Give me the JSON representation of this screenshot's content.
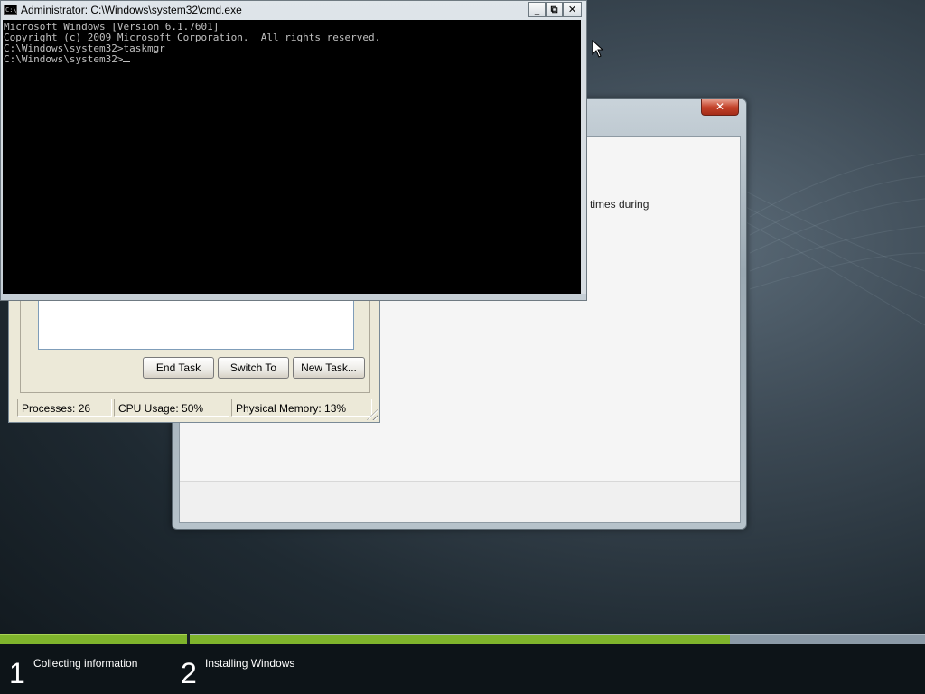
{
  "cmd_window": {
    "title": "Administrator: C:\\Windows\\system32\\cmd.exe",
    "icon": "cmd-console-icon",
    "icon_text": "C:\\",
    "controls": {
      "minimize": "_",
      "restore": "⧉",
      "close": "✕"
    },
    "console_lines": [
      "Microsoft Windows [Version 6.1.7601]",
      "Copyright (c) 2009 Microsoft Corporation.  All rights reserved.",
      "",
      "C:\\Windows\\system32>taskmgr",
      "",
      "C:\\Windows\\system32>"
    ]
  },
  "setup_window": {
    "close_label": "✕",
    "visible_text": "l times during"
  },
  "task_manager": {
    "buttons": {
      "end_task": "End Task",
      "switch_to": "Switch To",
      "new_task": "New Task..."
    },
    "status": {
      "processes": "Processes: 26",
      "cpu": "CPU Usage: 50%",
      "memory": "Physical Memory: 13%"
    }
  },
  "install_progress": {
    "stage2_fill_fraction": 0.735,
    "steps": [
      {
        "number": "1",
        "label": "Collecting information"
      },
      {
        "number": "2",
        "label": "Installing Windows"
      }
    ]
  },
  "colors": {
    "progress_green": "#7fb42c",
    "progress_gray": "#8b9aa7",
    "console_bg": "#000000",
    "console_text": "#c0c0c0",
    "close_red": "#c4432b"
  }
}
